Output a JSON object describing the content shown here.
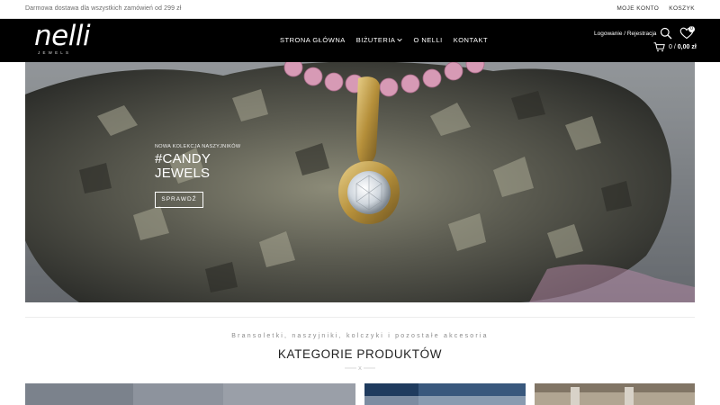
{
  "topbar": {
    "promo": "Darmowa dostawa dla wszystkich zamówień od 299 zł",
    "links": [
      "MOJE KONTO",
      "KOSZYK"
    ]
  },
  "header": {
    "logo": {
      "word": "nelli",
      "sub": "JEWELS"
    },
    "nav": [
      {
        "label": "STRONA GŁÓWNA",
        "has_sub": false
      },
      {
        "label": "BIŻUTERIA",
        "has_sub": true
      },
      {
        "label": "O NELLI",
        "has_sub": false
      },
      {
        "label": "KONTAKT",
        "has_sub": false
      }
    ],
    "account_link": "Logowanie / Rejestracja",
    "wishlist_count": "0",
    "cart": {
      "count": "0",
      "separator": "/",
      "amount": "0,00 zł"
    }
  },
  "hero": {
    "eyebrow": "NOWA KOLEKCJA NASZYJNIKÓW",
    "headline_line1": "#CANDY",
    "headline_line2": "JEWELS",
    "cta": "SPRAWDŹ"
  },
  "section": {
    "tagline": "Bransoletki, naszyjniki, kolczyki i pozostałe akcesoria",
    "title": "KATEGORIE PRODUKTÓW",
    "ornament": "X"
  },
  "icons": {
    "search": "search-icon",
    "wishlist": "heart-icon",
    "cart": "cart-icon",
    "submenu": "chevron-down-icon"
  },
  "colors": {
    "header_bg": "#000000",
    "text_light": "#ffffff",
    "accent_gold": "#c9a94a"
  }
}
